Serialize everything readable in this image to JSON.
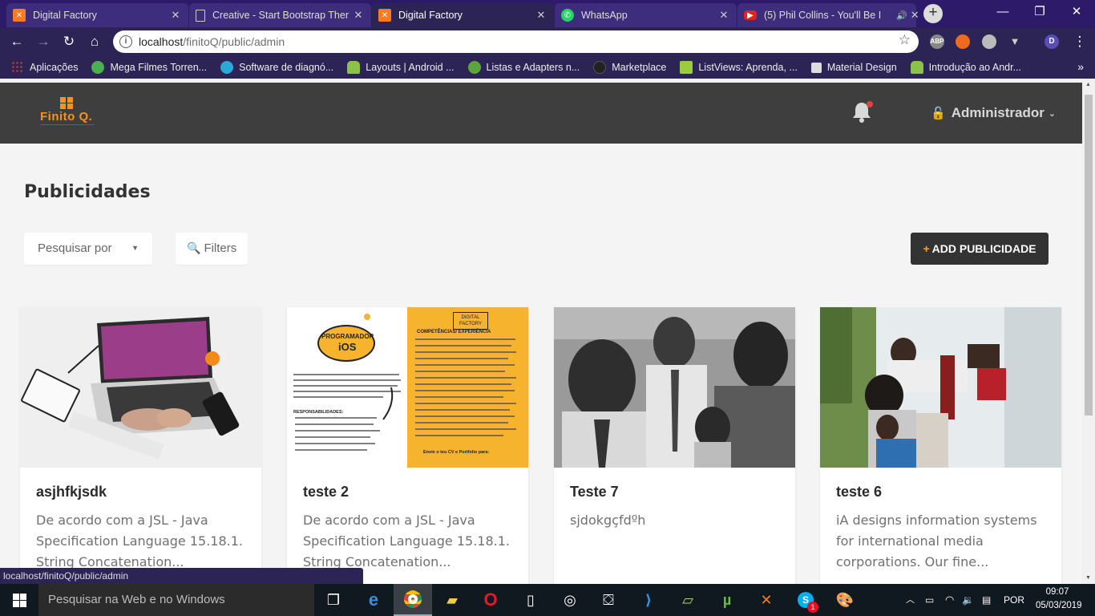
{
  "browser": {
    "tabs": [
      {
        "title": "Digital Factory",
        "icon": "xampp-icon",
        "active": false
      },
      {
        "title": "Creative - Start Bootstrap Ther",
        "icon": "document-icon",
        "active": false
      },
      {
        "title": "Digital Factory",
        "icon": "xampp-icon",
        "active": true
      },
      {
        "title": "WhatsApp",
        "icon": "whatsapp-icon",
        "active": false
      },
      {
        "title": "(5) Phil Collins - You'll Be I",
        "icon": "youtube-icon",
        "active": false
      }
    ],
    "address": {
      "host": "localhost",
      "path": "/finitoQ/public/admin"
    },
    "profile_initial": "D",
    "extensions": [
      "ABP",
      "extension-orange",
      "extension-skype",
      "extension-v"
    ],
    "bookmarks": [
      {
        "label": "Aplicações",
        "icon": "apps-grid-icon"
      },
      {
        "label": "Mega Filmes Torren...",
        "icon": "megafilmes-icon"
      },
      {
        "label": "Software de diagnó...",
        "icon": "m-icon"
      },
      {
        "label": "Layouts  |  Android ...",
        "icon": "android-icon"
      },
      {
        "label": "Listas e Adapters n...",
        "icon": "xda-icon"
      },
      {
        "label": "Marketplace",
        "icon": "github-icon"
      },
      {
        "label": "ListViews: Aprenda, ...",
        "icon": "listviews-icon"
      },
      {
        "label": "Material Design",
        "icon": "material-icon"
      },
      {
        "label": "Introdução ao Andr...",
        "icon": "android-icon"
      }
    ],
    "status_url": "localhost/finitoQ/public/admin"
  },
  "app": {
    "logo_text": "Finito Q.",
    "user_name": "Administrador",
    "page_title": "Publicidades",
    "search_by_label": "Pesquisar por",
    "filters_label": "Filters",
    "add_button_label": "ADD PUBLICIDADE",
    "cards": [
      {
        "title": "asjhfkjsdk",
        "description": "De acordo com a JSL - Java Specification Language 15.18.1. String Concatenation..."
      },
      {
        "title": "teste 2",
        "description": "De acordo com a JSL - Java Specification Language 15.18.1. String Concatenation..."
      },
      {
        "title": "Teste 7",
        "description": "sjdokgçfdºh"
      },
      {
        "title": "teste 6",
        "description": "iA designs information systems for international media corporations. Our fine..."
      }
    ],
    "poster": {
      "brand": "DIGITAL FACTORY",
      "heading_1": "PROGRAMADOR",
      "heading_2": "iOS",
      "section": "COMPETÊNCIAS/ EXPERIÊNCIA",
      "section_2": "RESPONSABILIDADES:",
      "contact": "Envie o teu CV e Portfolio para:"
    }
  },
  "taskbar": {
    "search_placeholder": "Pesquisar na Web e no Windows",
    "language": "POR",
    "time": "09:07",
    "date": "05/03/2019",
    "skype_badge": "1"
  }
}
